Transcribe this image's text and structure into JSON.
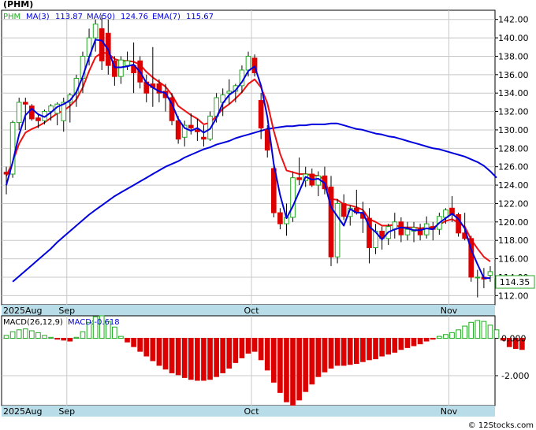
{
  "chart_data": [
    {
      "type": "candlestick",
      "title": "(PHM)",
      "legend": {
        "ticker": "PHM",
        "ma3_label": "MA(3)",
        "ma3_value": "113.87",
        "ma50_label": "MA(50)",
        "ma50_value": "124.76",
        "ema7_label": "EMA(7)",
        "ema7_value": "115.67"
      },
      "last_price_label": "114.35",
      "y_ticks": [
        "112.00",
        "114.00",
        "116.00",
        "118.00",
        "120.00",
        "122.00",
        "124.00",
        "126.00",
        "128.00",
        "130.00",
        "132.00",
        "134.00",
        "136.00",
        "138.00",
        "140.00",
        "142.00"
      ],
      "ylim": [
        111.0,
        143.0
      ],
      "x_labels": [
        {
          "label": "2025Aug",
          "index": 0
        },
        {
          "label": "Sep",
          "index": 10
        },
        {
          "label": "Oct",
          "index": 39
        },
        {
          "label": "Nov",
          "index": 70
        }
      ],
      "colors": {
        "up": "#22aa22",
        "down": "#dd0000",
        "ma3": "#0000dd",
        "ma50": "#0000dd",
        "ema7": "#ee1111",
        "axis_band": "#b8dde8",
        "grid": "#c8c8c8"
      },
      "ohlc": [
        [
          125.4,
          126.0,
          123.0,
          125.2
        ],
        [
          125.2,
          131.0,
          124.8,
          130.8
        ],
        [
          130.8,
          133.5,
          130.0,
          133.0
        ],
        [
          133.0,
          133.5,
          130.0,
          132.8
        ],
        [
          132.6,
          132.8,
          131.0,
          131.2
        ],
        [
          131.3,
          131.8,
          130.2,
          131.0
        ],
        [
          131.0,
          132.2,
          130.6,
          132.0
        ],
        [
          132.0,
          132.8,
          131.0,
          132.6
        ],
        [
          131.8,
          133.0,
          130.5,
          132.8
        ],
        [
          131.0,
          133.5,
          129.8,
          133.0
        ],
        [
          133.0,
          134.0,
          130.8,
          133.8
        ],
        [
          134.0,
          136.0,
          132.5,
          135.6
        ],
        [
          135.6,
          138.5,
          134.0,
          138.0
        ],
        [
          138.0,
          141.0,
          137.0,
          140.0
        ],
        [
          140.0,
          142.0,
          138.5,
          141.5
        ],
        [
          141.0,
          142.5,
          136.5,
          137.5
        ],
        [
          140.5,
          142.0,
          136.0,
          137.0
        ],
        [
          137.5,
          138.0,
          134.8,
          135.8
        ],
        [
          135.8,
          138.0,
          135.0,
          137.6
        ],
        [
          137.0,
          138.5,
          136.5,
          137.5
        ],
        [
          137.0,
          139.5,
          134.0,
          136.2
        ],
        [
          137.5,
          138.0,
          134.5,
          135.2
        ],
        [
          135.2,
          136.0,
          133.0,
          134.0
        ],
        [
          135.0,
          139.0,
          132.5,
          134.6
        ],
        [
          135.0,
          135.5,
          133.0,
          134.0
        ],
        [
          134.2,
          135.0,
          132.0,
          133.5
        ],
        [
          133.5,
          134.0,
          130.5,
          131.0
        ],
        [
          131.0,
          131.5,
          128.5,
          129.0
        ],
        [
          129.2,
          131.0,
          128.2,
          130.5
        ],
        [
          130.5,
          131.8,
          129.5,
          130.2
        ],
        [
          130.0,
          131.2,
          128.8,
          129.8
        ],
        [
          129.2,
          130.5,
          128.2,
          129.0
        ],
        [
          129.0,
          132.0,
          128.8,
          131.5
        ],
        [
          131.5,
          134.0,
          130.8,
          133.5
        ],
        [
          133.0,
          134.5,
          131.5,
          133.8
        ],
        [
          134.0,
          135.5,
          132.8,
          134.2
        ],
        [
          134.2,
          135.0,
          133.0,
          134.8
        ],
        [
          134.8,
          137.0,
          134.0,
          136.5
        ],
        [
          136.5,
          138.5,
          135.8,
          138.0
        ],
        [
          137.8,
          138.2,
          135.8,
          136.2
        ],
        [
          133.2,
          134.0,
          129.0,
          130.2
        ],
        [
          130.0,
          130.5,
          127.0,
          127.8
        ],
        [
          125.8,
          126.5,
          120.5,
          121.0
        ],
        [
          121.0,
          121.5,
          119.2,
          119.8
        ],
        [
          119.8,
          122.0,
          118.5,
          120.5
        ],
        [
          120.5,
          125.5,
          120.0,
          124.8
        ],
        [
          124.8,
          127.0,
          124.0,
          124.6
        ],
        [
          124.5,
          126.0,
          123.8,
          125.2
        ],
        [
          125.2,
          125.8,
          123.8,
          124.0
        ],
        [
          124.0,
          125.5,
          122.8,
          125.0
        ],
        [
          125.0,
          126.0,
          123.0,
          123.6
        ],
        [
          123.8,
          125.0,
          115.2,
          116.2
        ],
        [
          116.2,
          122.5,
          115.5,
          122.0
        ],
        [
          122.0,
          123.0,
          120.2,
          120.6
        ],
        [
          120.6,
          121.8,
          119.6,
          121.5
        ],
        [
          121.5,
          123.5,
          120.8,
          121.0
        ],
        [
          121.0,
          122.2,
          118.8,
          120.4
        ],
        [
          120.4,
          121.5,
          115.5,
          117.2
        ],
        [
          117.2,
          119.8,
          116.5,
          119.0
        ],
        [
          119.0,
          119.5,
          117.0,
          118.2
        ],
        [
          118.2,
          119.8,
          117.5,
          119.5
        ],
        [
          119.2,
          121.0,
          118.2,
          120.0
        ],
        [
          120.0,
          120.5,
          117.8,
          118.6
        ],
        [
          118.6,
          120.0,
          118.0,
          119.2
        ],
        [
          119.0,
          120.0,
          117.8,
          119.4
        ],
        [
          119.2,
          119.8,
          118.0,
          118.6
        ],
        [
          118.6,
          120.6,
          118.2,
          119.8
        ],
        [
          119.5,
          120.0,
          118.0,
          119.2
        ],
        [
          119.2,
          121.0,
          118.6,
          120.6
        ],
        [
          120.5,
          121.5,
          119.8,
          121.3
        ],
        [
          121.5,
          122.8,
          120.0,
          120.8
        ],
        [
          120.8,
          121.0,
          118.4,
          118.8
        ],
        [
          118.8,
          121.0,
          118.0,
          118.2
        ],
        [
          118.2,
          118.5,
          113.5,
          114.0
        ],
        [
          114.0,
          114.8,
          111.8,
          114.0
        ],
        [
          114.0,
          115.0,
          112.8,
          113.8
        ],
        [
          114.2,
          115.2,
          113.5,
          114.6
        ]
      ],
      "ma3": [
        124.0,
        126.5,
        129.5,
        131.6,
        132.3,
        131.7,
        131.4,
        131.9,
        132.5,
        132.8,
        133.2,
        134.1,
        135.8,
        137.9,
        139.8,
        139.7,
        138.7,
        136.8,
        136.8,
        136.9,
        137.1,
        136.3,
        135.1,
        134.6,
        134.2,
        134.0,
        132.8,
        131.2,
        130.2,
        129.9,
        130.2,
        129.7,
        130.1,
        131.3,
        132.9,
        133.8,
        134.3,
        135.2,
        136.4,
        136.9,
        134.8,
        131.4,
        126.3,
        122.9,
        120.4,
        121.7,
        123.3,
        124.9,
        124.6,
        124.7,
        124.2,
        121.6,
        120.6,
        119.6,
        121.4,
        121.0,
        121.0,
        119.5,
        118.9,
        118.1,
        118.9,
        119.2,
        119.4,
        119.3,
        119.1,
        119.1,
        119.3,
        119.2,
        119.9,
        120.4,
        120.9,
        120.3,
        119.3,
        117.0,
        115.4,
        113.9,
        113.9
      ],
      "ema7": [
        125.0,
        126.5,
        128.5,
        129.7,
        130.1,
        130.4,
        130.8,
        131.3,
        131.8,
        132.1,
        132.6,
        133.3,
        134.6,
        136.4,
        137.9,
        138.4,
        138.3,
        137.7,
        137.5,
        137.5,
        137.4,
        137.1,
        136.3,
        135.7,
        135.2,
        134.7,
        133.8,
        132.6,
        132.1,
        131.6,
        131.2,
        130.6,
        130.8,
        131.5,
        132.3,
        132.8,
        133.4,
        134.1,
        135.0,
        135.5,
        134.6,
        132.9,
        129.9,
        127.4,
        125.6,
        125.4,
        125.2,
        125.2,
        125.1,
        125.0,
        124.6,
        122.5,
        122.4,
        121.9,
        121.8,
        121.6,
        121.3,
        120.3,
        120.0,
        119.6,
        119.6,
        119.7,
        119.4,
        119.4,
        119.4,
        119.3,
        119.4,
        119.4,
        119.7,
        120.1,
        120.3,
        119.9,
        119.5,
        118.1,
        117.1,
        116.2,
        115.7
      ],
      "ma50": [
        113.5,
        114.1,
        114.7,
        115.3,
        115.9,
        116.5,
        117.1,
        117.8,
        118.4,
        119.0,
        119.6,
        120.2,
        120.8,
        121.3,
        121.8,
        122.3,
        122.8,
        123.2,
        123.6,
        124.0,
        124.4,
        124.8,
        125.2,
        125.6,
        126.0,
        126.3,
        126.6,
        127.0,
        127.3,
        127.6,
        127.9,
        128.1,
        128.4,
        128.6,
        128.8,
        129.1,
        129.3,
        129.5,
        129.7,
        129.9,
        130.1,
        130.2,
        130.3,
        130.4,
        130.4,
        130.5,
        130.5,
        130.6,
        130.6,
        130.6,
        130.7,
        130.7,
        130.5,
        130.3,
        130.1,
        130.0,
        129.8,
        129.6,
        129.5,
        129.3,
        129.2,
        129.0,
        128.8,
        128.6,
        128.4,
        128.2,
        128.0,
        127.9,
        127.7,
        127.5,
        127.3,
        127.1,
        126.8,
        126.5,
        126.1,
        125.5,
        124.8
      ],
      "ma50_start_index": 1
    },
    {
      "type": "bar",
      "title": "MACD(26,12,9)",
      "legend_label": "MACD:-0.618",
      "y_ticks": [
        "0.000",
        "-2.000"
      ],
      "ylim": [
        -3.6,
        1.2
      ],
      "x_labels": [
        {
          "label": "2025Aug",
          "index": 0
        },
        {
          "label": "Sep",
          "index": 10
        },
        {
          "label": "Oct",
          "index": 39
        },
        {
          "label": "Nov",
          "index": 70
        }
      ],
      "colors": {
        "up": "#22aa22",
        "down": "#dd0000"
      },
      "values": [
        0.15,
        0.35,
        0.45,
        0.5,
        0.4,
        0.3,
        0.15,
        0.05,
        -0.05,
        -0.1,
        -0.15,
        0.05,
        0.35,
        0.85,
        1.15,
        1.2,
        0.9,
        0.6,
        0.1,
        -0.2,
        -0.45,
        -0.7,
        -0.95,
        -1.2,
        -1.45,
        -1.65,
        -1.85,
        -1.95,
        -2.1,
        -2.2,
        -2.25,
        -2.25,
        -2.2,
        -2.05,
        -1.85,
        -1.6,
        -1.3,
        -1.05,
        -0.8,
        -0.7,
        -1.15,
        -1.7,
        -2.35,
        -2.9,
        -3.4,
        -3.6,
        -3.3,
        -2.85,
        -2.45,
        -2.05,
        -1.8,
        -1.6,
        -1.45,
        -1.45,
        -1.4,
        -1.35,
        -1.25,
        -1.15,
        -1.1,
        -0.95,
        -0.85,
        -0.75,
        -0.6,
        -0.5,
        -0.4,
        -0.3,
        -0.15,
        -0.05,
        0.1,
        0.2,
        0.3,
        0.45,
        0.65,
        0.85,
        0.95,
        0.9,
        0.7,
        0.45,
        -0.1,
        -0.45,
        -0.55,
        -0.6
      ]
    }
  ],
  "footer": "© 12Stocks.com"
}
